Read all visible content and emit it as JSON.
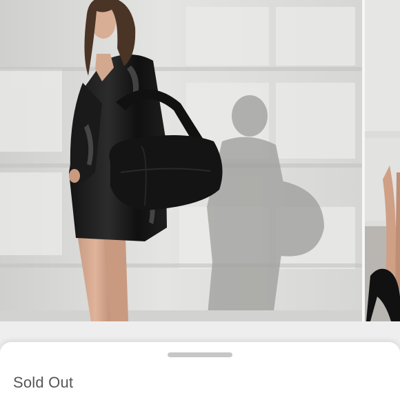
{
  "carousel": {
    "slides": [
      {
        "subject": "model-with-black-shoulder-bag"
      },
      {
        "subject": "black-heel-shoe"
      }
    ],
    "current_index": 0
  },
  "sheet": {
    "status": "Sold Out"
  },
  "colors": {
    "status_text": "#555555",
    "handle": "#c7c7c7",
    "sheet_background": "#ffffff",
    "wall": "#dcdcda"
  }
}
